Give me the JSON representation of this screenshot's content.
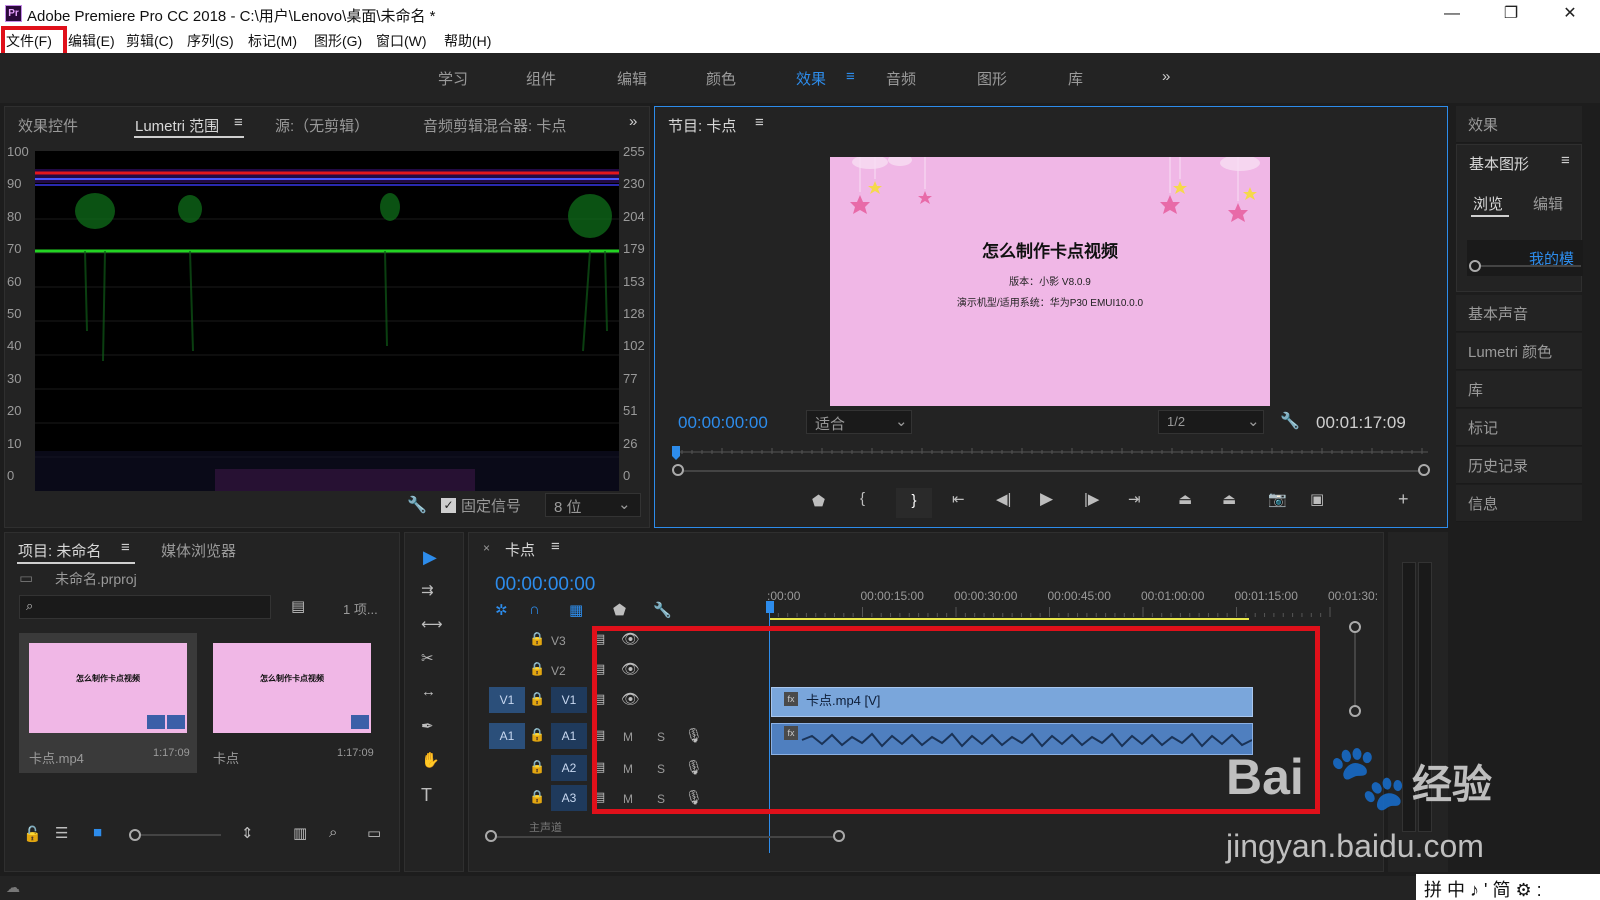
{
  "window": {
    "title": "Adobe Premiere Pro CC 2018 - C:\\用户\\Lenovo\\桌面\\未命名 *",
    "app_icon": "Pr"
  },
  "menu": [
    "文件(F)",
    "编辑(E)",
    "剪辑(C)",
    "序列(S)",
    "标记(M)",
    "图形(G)",
    "窗口(W)",
    "帮助(H)"
  ],
  "workspaces": [
    "学习",
    "组件",
    "编辑",
    "颜色",
    "效果",
    "音频",
    "图形",
    "库"
  ],
  "source_panel": {
    "tabs": [
      "效果控件",
      "Lumetri 范围",
      "源:（无剪辑）",
      "音频剪辑混合器: 卡点"
    ],
    "left_ticks": [
      "100",
      "90",
      "80",
      "70",
      "60",
      "50",
      "40",
      "30",
      "20",
      "10",
      "0"
    ],
    "right_ticks": [
      "255",
      "230",
      "204",
      "179",
      "153",
      "128",
      "102",
      "77",
      "51",
      "26",
      "0"
    ],
    "clamp_label": "固定信号",
    "bit_depth": "8 位"
  },
  "program": {
    "tab": "节目: 卡点",
    "frame_title": "怎么制作卡点视频",
    "frame_line1": "版本：小影 V8.0.9",
    "frame_line2": "演示机型/适用系统：华为P30 EMUI10.0.0",
    "timecode": "00:00:00:00",
    "zoom": "适合",
    "resolution": "1/2",
    "duration": "00:01:17:09"
  },
  "right_panel": {
    "effects": "效果",
    "essential_graphics": "基本图形",
    "browse": "浏览",
    "edit": "编辑",
    "my_templates": "我的模",
    "items": [
      "基本声音",
      "Lumetri 颜色",
      "库",
      "标记",
      "历史记录",
      "信息"
    ]
  },
  "project": {
    "tab": "项目: 未命名",
    "media_tab": "媒体浏览器",
    "file": "未命名.prproj",
    "item_count": "1 项...",
    "items": [
      {
        "name": "卡点.mp4",
        "duration": "1:17:09"
      },
      {
        "name": "卡点",
        "duration": "1:17:09"
      }
    ],
    "thumb_title": "怎么制作卡点视频"
  },
  "timeline": {
    "tab": "卡点",
    "timecode": "00:00:00:00",
    "ruler": [
      ":00:00",
      "00:00:15:00",
      "00:00:30:00",
      "00:00:45:00",
      "00:01:00:00",
      "00:01:15:00",
      "00:01:30:"
    ],
    "tracks": [
      "V3",
      "V2",
      "V1",
      "A1",
      "A2",
      "A3"
    ],
    "src_v": "V1",
    "src_a": "A1",
    "clip_video": "卡点.mp4 [V]",
    "mix_label": "主声道",
    "m_label": "M",
    "s_label": "S"
  },
  "watermark": {
    "brand": "Bai",
    "brand2": "经验",
    "url": "jingyan.baidu.com"
  },
  "ime": "拼 中 ♪ ' 简 ⚙ :"
}
